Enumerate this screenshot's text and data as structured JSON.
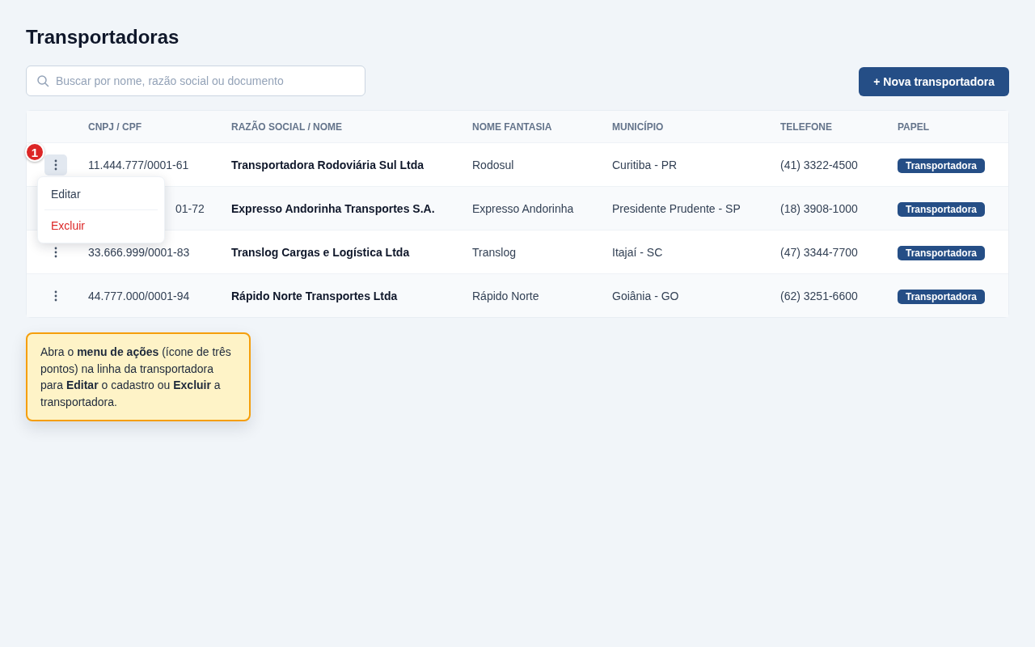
{
  "title": "Transportadoras",
  "search": {
    "placeholder": "Buscar por nome, razão social ou documento"
  },
  "new_button": "+ Nova transportadora",
  "table": {
    "columns": [
      "CNPJ / CPF",
      "RAZÃO SOCIAL / NOME",
      "NOME FANTASIA",
      "MUNICÍPIO",
      "TELEFONE",
      "PAPEL"
    ],
    "rows": [
      {
        "document": "11.444.777/0001-61",
        "document_covered": false,
        "name": "Transportadora Rodoviária Sul Ltda",
        "trade_name": "Rodosul",
        "city": "Curitiba - PR",
        "phone": "(41) 3322-4500",
        "role": "Transportadora",
        "menu_open": true
      },
      {
        "document": "01-72",
        "document_covered": true,
        "name": "Expresso Andorinha Transportes S.A.",
        "trade_name": "Expresso Andorinha",
        "city": "Presidente Prudente - SP",
        "phone": "(18) 3908-1000",
        "role": "Transportadora",
        "menu_open": false
      },
      {
        "document": "33.666.999/0001-83",
        "document_covered": false,
        "name": "Translog Cargas e Logística Ltda",
        "trade_name": "Translog",
        "city": "Itajaí - SC",
        "phone": "(47) 3344-7700",
        "role": "Transportadora",
        "menu_open": false
      },
      {
        "document": "44.777.000/0001-94",
        "document_covered": false,
        "name": "Rápido Norte Transportes Ltda",
        "trade_name": "Rápido Norte",
        "city": "Goiânia - GO",
        "phone": "(62) 3251-6600",
        "role": "Transportadora",
        "menu_open": false
      }
    ]
  },
  "action_menu": {
    "items": [
      {
        "label": "Editar",
        "kind": "normal"
      },
      {
        "label": "Excluir",
        "kind": "danger"
      }
    ]
  },
  "step_badge": "1",
  "hint": "Abra o **menu de ações** (ícone de três pontos) na linha da transportadora para **Editar** o cadastro ou **Excluir** a transportadora."
}
